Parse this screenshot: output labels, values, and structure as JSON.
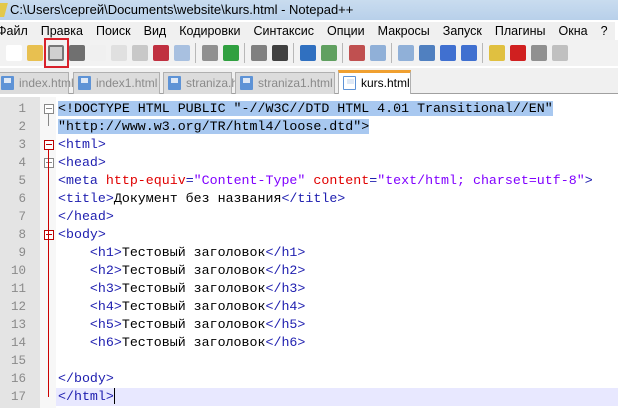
{
  "window": {
    "title": "C:\\Users\\сергей\\Documents\\website\\kurs.html - Notepad++"
  },
  "menu": [
    "Файл",
    "Правка",
    "Поиск",
    "Вид",
    "Кодировки",
    "Синтаксис",
    "Опции",
    "Макросы",
    "Запуск",
    "Плагины",
    "Окна",
    "?"
  ],
  "toolbar": {
    "buttons": [
      "new-file",
      "open-file",
      "save",
      "save-all",
      "close",
      "close-all",
      "print",
      "cut",
      "copy",
      "paste",
      "undo",
      "redo",
      "find",
      "replace",
      "zoom-in",
      "zoom-out",
      "sync-vertical",
      "sync-horizontal",
      "word-wrap",
      "show-all-chars",
      "indent-guide",
      "user-language",
      "record-macro",
      "stop-record",
      "play-macro"
    ],
    "highlighted_button": "save",
    "highlight_color": "#d8202a"
  },
  "tabs": [
    {
      "label": "index.html",
      "active": false
    },
    {
      "label": "index1.html",
      "active": false
    },
    {
      "label": "straniza.html",
      "active": false
    },
    {
      "label": "straniza1.html",
      "active": false
    },
    {
      "label": "kurs.html",
      "active": true
    }
  ],
  "editor": {
    "current_line": 17,
    "lines": [
      {
        "n": "1",
        "seg": [
          [
            "<!DOCTYPE HTML PUBLIC \"-//W3C//DTD HTML 4.01 Transitional//EN\"",
            "doc"
          ]
        ]
      },
      {
        "n": "2",
        "seg": [
          [
            "\"http://www.w3.org/TR/html4/loose.dtd\">",
            "doc"
          ]
        ]
      },
      {
        "n": "3",
        "seg": [
          [
            "<html>",
            "tag"
          ]
        ]
      },
      {
        "n": "4",
        "seg": [
          [
            "<head>",
            "tag"
          ]
        ]
      },
      {
        "n": "5",
        "seg": [
          [
            "<meta ",
            "tag"
          ],
          [
            "http-equiv",
            "attr"
          ],
          [
            "=",
            "tag"
          ],
          [
            "\"Content-Type\"",
            "val"
          ],
          [
            " ",
            "txt"
          ],
          [
            "content",
            "attr"
          ],
          [
            "=",
            "tag"
          ],
          [
            "\"text/html; charset=utf-8\"",
            "val"
          ],
          [
            ">",
            "tag"
          ]
        ]
      },
      {
        "n": "6",
        "seg": [
          [
            "<title>",
            "tag"
          ],
          [
            "Документ без названия",
            "txt"
          ],
          [
            "</title>",
            "tag"
          ]
        ]
      },
      {
        "n": "7",
        "seg": [
          [
            "</head>",
            "tag"
          ]
        ]
      },
      {
        "n": "8",
        "seg": [
          [
            "<body>",
            "tag"
          ]
        ]
      },
      {
        "n": "9",
        "seg": [
          [
            "    ",
            "txt"
          ],
          [
            "<h1>",
            "tag"
          ],
          [
            "Тестовый заголовок",
            "txt"
          ],
          [
            "</h1>",
            "tag"
          ]
        ]
      },
      {
        "n": "10",
        "seg": [
          [
            "    ",
            "txt"
          ],
          [
            "<h2>",
            "tag"
          ],
          [
            "Тестовый заголовок",
            "txt"
          ],
          [
            "</h2>",
            "tag"
          ]
        ]
      },
      {
        "n": "11",
        "seg": [
          [
            "    ",
            "txt"
          ],
          [
            "<h3>",
            "tag"
          ],
          [
            "Тестовый заголовок",
            "txt"
          ],
          [
            "</h3>",
            "tag"
          ]
        ]
      },
      {
        "n": "12",
        "seg": [
          [
            "    ",
            "txt"
          ],
          [
            "<h4>",
            "tag"
          ],
          [
            "Тестовый заголовок",
            "txt"
          ],
          [
            "</h4>",
            "tag"
          ]
        ]
      },
      {
        "n": "13",
        "seg": [
          [
            "    ",
            "txt"
          ],
          [
            "<h5>",
            "tag"
          ],
          [
            "Тестовый заголовок",
            "txt"
          ],
          [
            "</h5>",
            "tag"
          ]
        ]
      },
      {
        "n": "14",
        "seg": [
          [
            "    ",
            "txt"
          ],
          [
            "<h6>",
            "tag"
          ],
          [
            "Тестовый заголовок",
            "txt"
          ],
          [
            "</h6>",
            "tag"
          ]
        ]
      },
      {
        "n": "15",
        "seg": []
      },
      {
        "n": "16",
        "seg": [
          [
            "</body>",
            "tag"
          ]
        ]
      },
      {
        "n": "17",
        "seg": [
          [
            "</html>",
            "tag"
          ]
        ]
      }
    ]
  }
}
